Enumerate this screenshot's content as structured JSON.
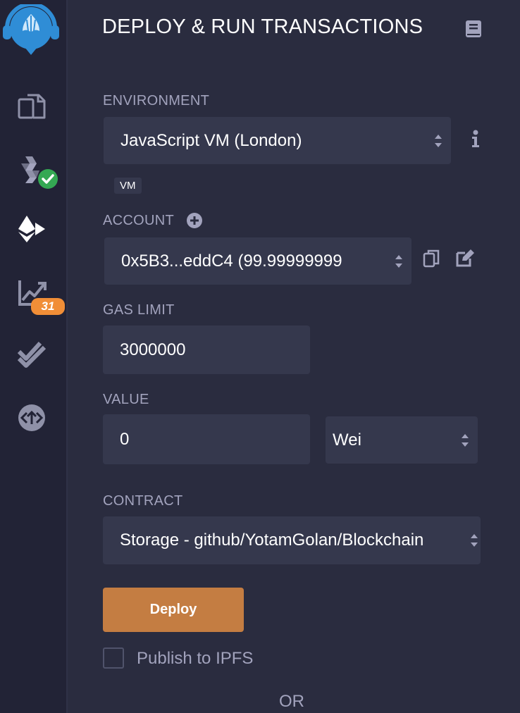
{
  "sidebar": {
    "items": [
      {
        "name": "remix-logo-icon"
      },
      {
        "name": "file-explorer-icon"
      },
      {
        "name": "solidity-compiler-icon"
      },
      {
        "name": "deploy-run-icon"
      },
      {
        "name": "analytics-icon",
        "badge": "31"
      },
      {
        "name": "tests-checkmark-icon"
      },
      {
        "name": "plugin-manager-icon"
      }
    ]
  },
  "header": {
    "title": "DEPLOY & RUN TRANSACTIONS"
  },
  "environment": {
    "label": "ENVIRONMENT",
    "value": "JavaScript VM (London)",
    "tag": "VM"
  },
  "account": {
    "label": "ACCOUNT",
    "value": "0x5B3...eddC4 (99.99999999"
  },
  "gas_limit": {
    "label": "GAS LIMIT",
    "value": "3000000"
  },
  "value_field": {
    "label": "VALUE",
    "value": "0",
    "unit": "Wei"
  },
  "contract": {
    "label": "CONTRACT",
    "value": "Storage - github/YotamGolan/Blockchain"
  },
  "deploy": {
    "label": "Deploy"
  },
  "publish": {
    "label": "Publish to IPFS",
    "checked": false
  },
  "or_text": "OR",
  "colors": {
    "panel_bg": "#2a2c3f",
    "sidebar_bg": "#222336",
    "field_bg": "#35384d",
    "deploy_button": "#c47d42",
    "badge": "#f18e37",
    "success_check": "#34a853"
  }
}
